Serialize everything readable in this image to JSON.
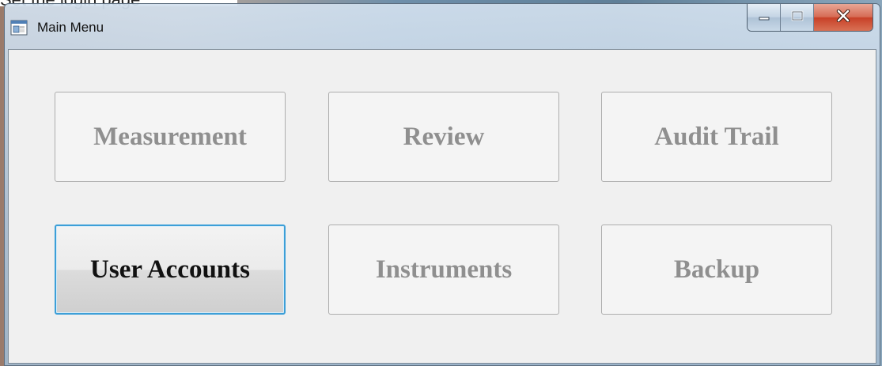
{
  "above_window_text": "Set the login page",
  "window": {
    "title": "Main Menu",
    "icons": {
      "app": "app-window-icon",
      "minimize": "minimize-icon",
      "maximize": "maximize-icon",
      "close": "close-icon"
    }
  },
  "menu": {
    "buttons": [
      {
        "label": "Measurement",
        "active": false
      },
      {
        "label": "Review",
        "active": false
      },
      {
        "label": "Audit Trail",
        "active": false
      },
      {
        "label": "User Accounts",
        "active": true
      },
      {
        "label": "Instruments",
        "active": false
      },
      {
        "label": "Backup",
        "active": false
      }
    ]
  },
  "colors": {
    "active_border": "#3c9fd8",
    "close_button": "#c84128",
    "disabled_text": "#8f8f8f"
  }
}
